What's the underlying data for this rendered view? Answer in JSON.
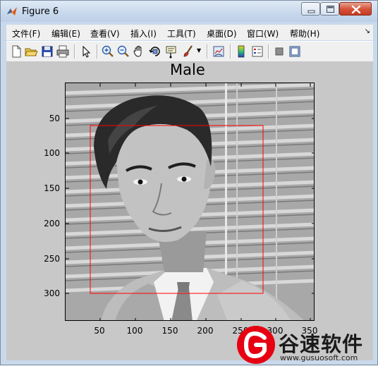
{
  "window": {
    "title": "Figure 6"
  },
  "menu": {
    "items": [
      "文件(F)",
      "编辑(E)",
      "查看(V)",
      "插入(I)",
      "工具(T)",
      "桌面(D)",
      "窗口(W)",
      "帮助(H)"
    ]
  },
  "toolbar": {
    "icons": [
      "new-figure-icon",
      "open-file-icon",
      "save-icon",
      "print-icon",
      "edit-plot-icon",
      "zoom-in-icon",
      "zoom-out-icon",
      "pan-icon",
      "rotate-3d-icon",
      "data-cursor-icon",
      "brush-icon",
      "link-plot-icon",
      "colorbar-icon",
      "legend-icon",
      "hide-plot-tools-icon",
      "show-plot-tools-icon"
    ]
  },
  "figure": {
    "title": "Male",
    "detection_box_color": "#ff0000",
    "background": "#c8c8c8"
  },
  "axes": {
    "y_ticks": [
      "50",
      "100",
      "150",
      "200",
      "250",
      "300"
    ],
    "x_ticks": [
      "50",
      "100",
      "150",
      "200",
      "250",
      "300",
      "350"
    ]
  },
  "watermark": {
    "brand": "谷速软件",
    "url": "www.gusuosoft.com"
  }
}
